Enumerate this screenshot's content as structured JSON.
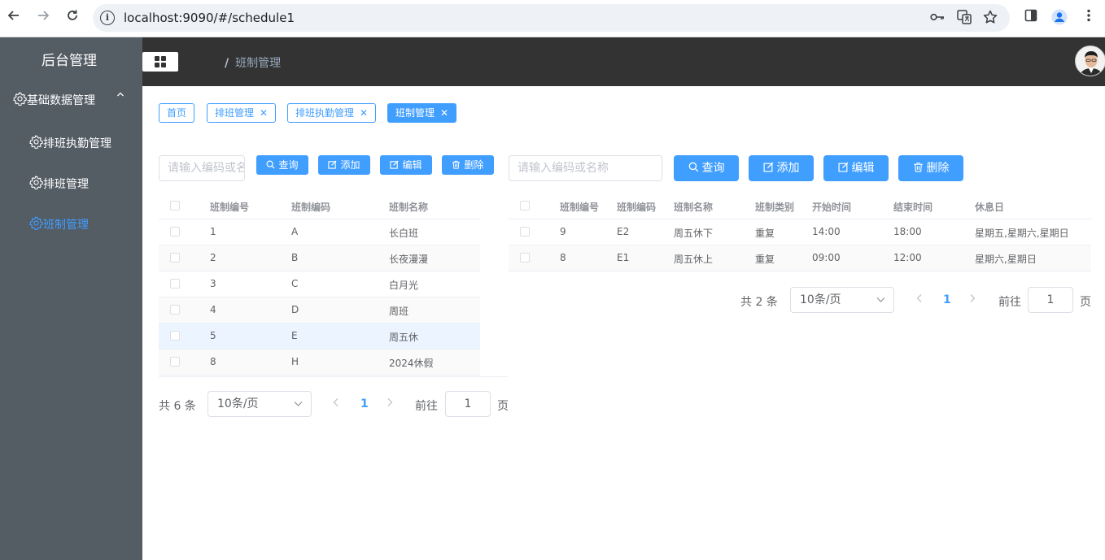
{
  "browser": {
    "url": "localhost:9090/#/schedule1"
  },
  "sidebar": {
    "title": "后台管理",
    "group_label": "基础数据管理",
    "items": [
      {
        "label": "排班执勤管理"
      },
      {
        "label": "排班管理"
      },
      {
        "label": "班制管理"
      }
    ]
  },
  "header": {
    "breadcrumb_sep": "/",
    "breadcrumb": "班制管理"
  },
  "tags": [
    {
      "label": "首页"
    },
    {
      "label": "排班管理"
    },
    {
      "label": "排班执勤管理"
    },
    {
      "label": "班制管理"
    }
  ],
  "left_panel": {
    "search_placeholder": "请输入编码或名称",
    "buttons": {
      "query": "查询",
      "add": "添加",
      "edit": "编辑",
      "delete": "删除"
    },
    "columns": [
      "班制编号",
      "班制编码",
      "班制名称"
    ],
    "rows": [
      [
        "1",
        "A",
        "长白班"
      ],
      [
        "2",
        "B",
        "长夜漫漫"
      ],
      [
        "3",
        "C",
        "白月光"
      ],
      [
        "4",
        "D",
        "周班"
      ],
      [
        "5",
        "E",
        "周五休"
      ],
      [
        "8",
        "H",
        "2024休假"
      ]
    ],
    "pagination": {
      "total": "共 6 条",
      "page_size": "10条/页",
      "current": "1",
      "goto_label": "前往",
      "goto_value": "1",
      "page_unit": "页"
    }
  },
  "right_panel": {
    "search_placeholder": "请输入编码或名称",
    "buttons": {
      "query": "查询",
      "add": "添加",
      "edit": "编辑",
      "delete": "删除"
    },
    "columns": [
      "班制编号",
      "班制编码",
      "班制名称",
      "班制类别",
      "开始时间",
      "结束时间",
      "休息日"
    ],
    "rows": [
      [
        "9",
        "E2",
        "周五休下",
        "重复",
        "14:00",
        "18:00",
        "星期五,星期六,星期日"
      ],
      [
        "8",
        "E1",
        "周五休上",
        "重复",
        "09:00",
        "12:00",
        "星期六,星期日"
      ]
    ],
    "pagination": {
      "total": "共 2 条",
      "page_size": "10条/页",
      "current": "1",
      "goto_label": "前往",
      "goto_value": "1",
      "page_unit": "页"
    }
  },
  "colors": {
    "primary": "#409eff",
    "sidebar_bg": "#545c64",
    "header_bg": "#333333"
  }
}
